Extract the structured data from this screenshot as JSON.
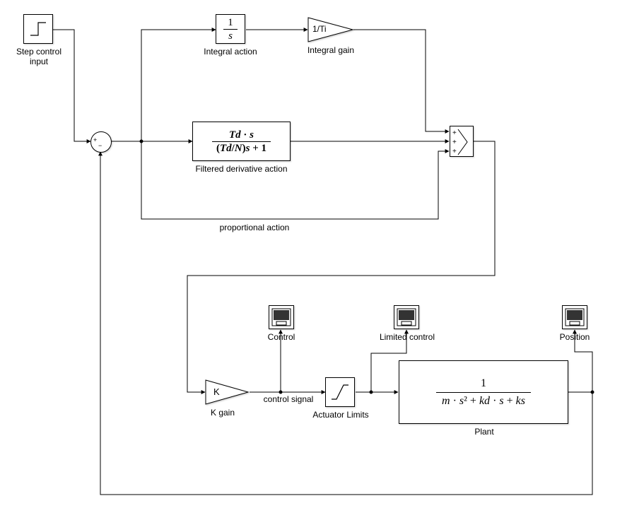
{
  "blocks": {
    "step": {
      "label": "Step control\ninput"
    },
    "integrator": {
      "label": "Integral action",
      "num": "1",
      "den": "s"
    },
    "integral_gain": {
      "label": "Integral gain",
      "text": "1/Ti"
    },
    "filtered_deriv": {
      "label": "Filtered derivative action",
      "num": "Td · s",
      "den": "(Td/N)s + 1"
    },
    "prop_action": {
      "label": "proportional action"
    },
    "k_gain": {
      "label": "K gain",
      "text": "K"
    },
    "control_signal": {
      "label": "control signal"
    },
    "actuator": {
      "label": "Actuator Limits"
    },
    "plant": {
      "label": "Plant",
      "num": "1",
      "den": "m · s² + kd · s + ks"
    },
    "scope_control": {
      "label": "Control"
    },
    "scope_limited": {
      "label": "Limited control"
    },
    "scope_position": {
      "label": "Position"
    },
    "sum": {
      "ports": "+−"
    },
    "sum3": {
      "ports": "+++"
    }
  }
}
